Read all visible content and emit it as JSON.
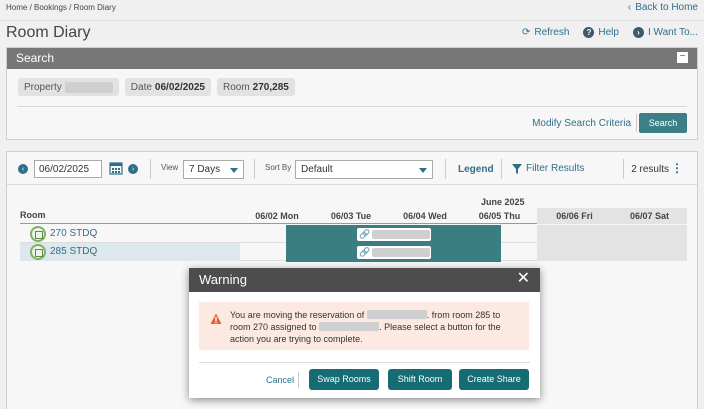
{
  "breadcrumb": "Home / Bookings / Room Diary",
  "back_home": "Back to Home",
  "page_title": "Room Diary",
  "actions": {
    "refresh": "Refresh",
    "help": "Help",
    "i_want_to": "I Want To..."
  },
  "search": {
    "header": "Search",
    "property_label": "Property",
    "date_label": "Date",
    "date_value": "06/02/2025",
    "room_label": "Room",
    "room_value": "270,285",
    "modify_link": "Modify Search Criteria",
    "search_button": "Search"
  },
  "toolbar": {
    "date_value": "06/02/2025",
    "view_label": "View",
    "view_value": "7 Days",
    "sort_label": "Sort By",
    "sort_value": "Default",
    "legend": "Legend",
    "filter": "Filter Results",
    "results": "2 results"
  },
  "grid": {
    "month": "June 2025",
    "room_header": "Room",
    "days": [
      {
        "label": "06/02 Mon",
        "weekend": false
      },
      {
        "label": "06/03 Tue",
        "weekend": false
      },
      {
        "label": "06/04 Wed",
        "weekend": false
      },
      {
        "label": "06/05 Thu",
        "weekend": false
      },
      {
        "label": "06/06 Fri",
        "weekend": true
      },
      {
        "label": "06/07 Sat",
        "weekend": true
      }
    ],
    "rooms": [
      {
        "name": "270  STDQ"
      },
      {
        "name": "285  STDQ"
      }
    ]
  },
  "modal": {
    "title": "Warning",
    "msg_part1": "You are moving the reservation of ",
    "msg_part2": ". from room 285 to room 270 assigned to ",
    "msg_part3": ". Please select a button for the action you are trying to complete.",
    "cancel": "Cancel",
    "swap_rooms": "Swap Rooms",
    "shift_room": "Shift Room",
    "create_share": "Create Share"
  },
  "colors": {
    "accent": "#2f6f8a",
    "reservation": "#3b7e82",
    "button": "#166c75",
    "warning_bg": "#fbe9e2"
  }
}
